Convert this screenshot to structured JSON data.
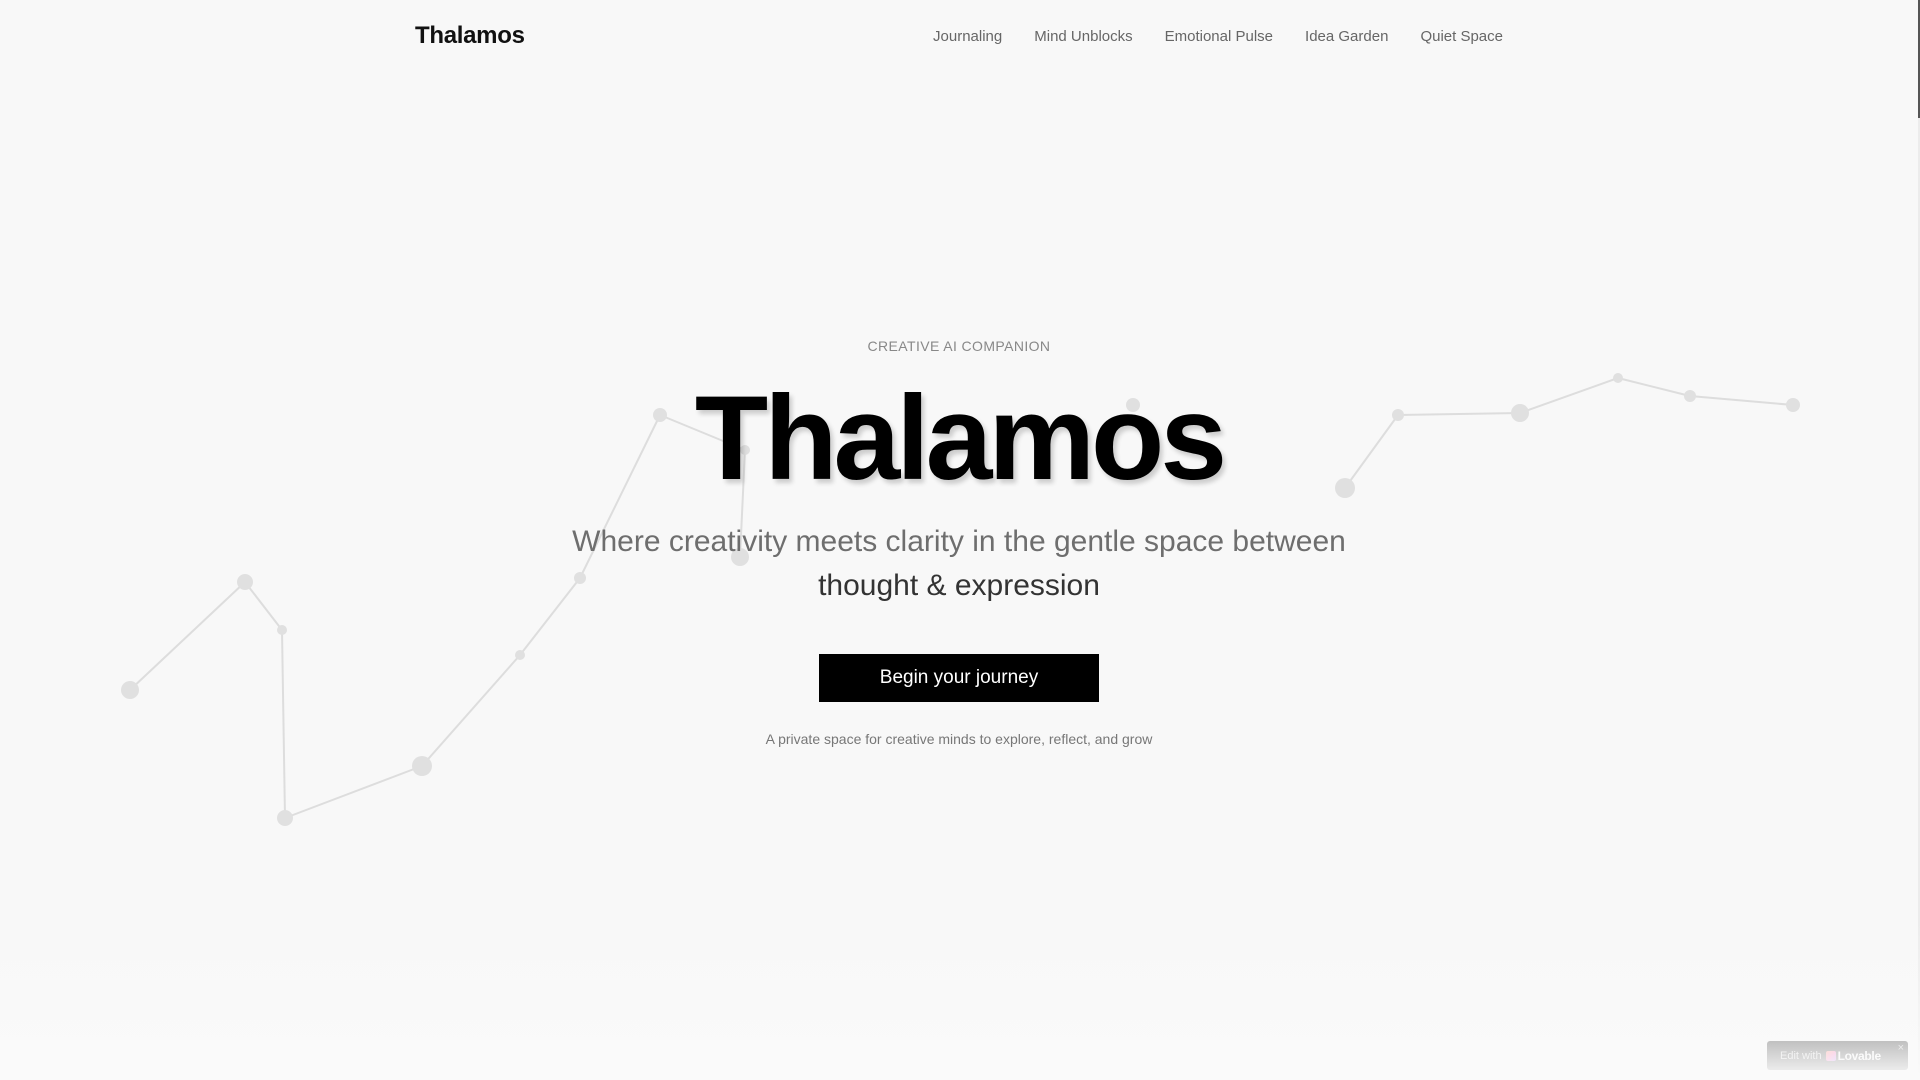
{
  "header": {
    "brand": "Thalamos",
    "nav": [
      {
        "label": "Journaling"
      },
      {
        "label": "Mind Unblocks"
      },
      {
        "label": "Emotional Pulse"
      },
      {
        "label": "Idea Garden"
      },
      {
        "label": "Quiet Space"
      }
    ]
  },
  "hero": {
    "eyebrow": "CREATIVE AI COMPANION",
    "title": "Thalamos",
    "tagline_line1": "Where creativity meets clarity in the gentle space between",
    "tagline_line2": "thought & expression",
    "cta_label": "Begin your journey",
    "sub_note": "A private space for creative minds to explore, reflect, and grow"
  },
  "badge": {
    "prefix": "Edit with",
    "brand": "Lovable",
    "close": "×"
  },
  "colors": {
    "background": "#f8f8f8",
    "accent": "#000000",
    "text_muted": "#6e6e6e"
  }
}
